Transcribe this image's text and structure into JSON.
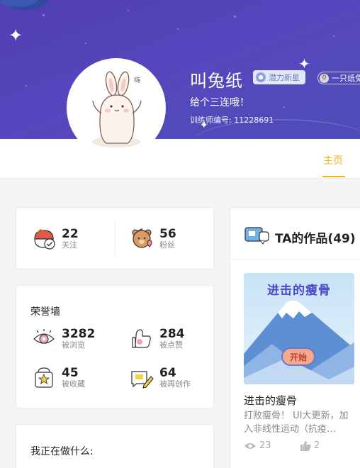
{
  "profile": {
    "username": "叫兔纸",
    "level_badge": "潜力新星",
    "group_badge_icon": "0",
    "group_badge": "一只纸兔",
    "bio": "给个三连哦！",
    "trainer_id": "训练师编号: 11228691"
  },
  "tabs": {
    "home": "主页"
  },
  "follow_stats": [
    {
      "value": "22",
      "label": "关注",
      "icon": "following-icon"
    },
    {
      "value": "56",
      "label": "粉丝",
      "icon": "fans-icon"
    }
  ],
  "honor_wall": {
    "title": "荣誉墙",
    "items": [
      {
        "value": "3282",
        "label": "被浏览",
        "icon": "eye-icon"
      },
      {
        "value": "284",
        "label": "被点赞",
        "icon": "like-icon"
      },
      {
        "value": "45",
        "label": "被收藏",
        "icon": "collect-icon"
      },
      {
        "value": "64",
        "label": "被再创作",
        "icon": "recreate-icon"
      }
    ]
  },
  "doing": {
    "title": "我正在做什么:"
  },
  "works": {
    "title": "TA的作品(49)",
    "items": [
      {
        "cover_title": "进击的瘦骨",
        "cover_button": "开始",
        "name": "进击的瘦骨",
        "description": "打败瘦骨！ UI大更新，加入非线性运动（抗疫…",
        "views": "23",
        "likes": "2"
      }
    ]
  },
  "colors": {
    "banner": "#5143b8",
    "accent": "#f2b21d",
    "text": "#222222",
    "muted": "#888888"
  }
}
